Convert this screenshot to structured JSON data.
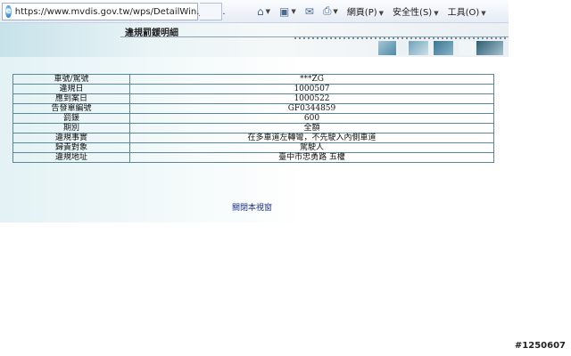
{
  "browser": {
    "address": "https://www.mvdis.gov.tw/wps/DetailWin.jsp?...",
    "menus": {
      "page": "網頁(P)",
      "safety": "安全性(S)",
      "tools": "工具(O)"
    }
  },
  "header": {
    "title": "違規罰鍰明細"
  },
  "details": [
    {
      "label": "車號/駕號",
      "value": "***ZG"
    },
    {
      "label": "違規日",
      "value": "1000507"
    },
    {
      "label": "應到案日",
      "value": "1000522"
    },
    {
      "label": "告發單編號",
      "value": "GF0344859"
    },
    {
      "label": "罰鍰",
      "value": "600"
    },
    {
      "label": "期別",
      "value": "全額"
    },
    {
      "label": "違規事實",
      "value": "在多車道左轉彎，不先駛入內側車道"
    },
    {
      "label": "歸責對象",
      "value": "駕駛人"
    },
    {
      "label": "違規地址",
      "value": "臺中市忠勇路 五權"
    }
  ],
  "close_label": "關閉本視窗",
  "watermark": "#1250607",
  "colors": {
    "border": "#5b8796",
    "link": "#1b2f8a"
  }
}
